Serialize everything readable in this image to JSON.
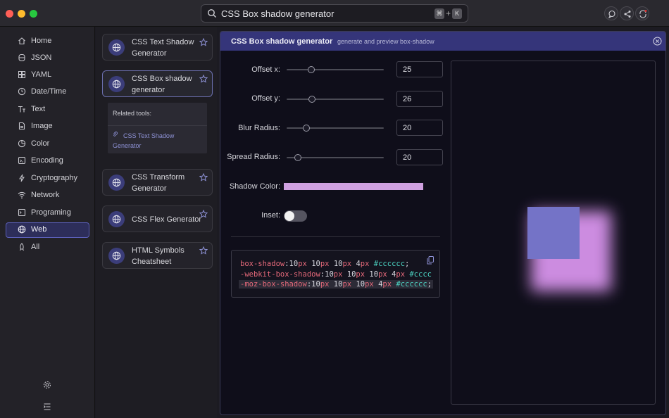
{
  "window": {
    "traffic_colors": [
      "#ff5f57",
      "#febc2e",
      "#28c840"
    ]
  },
  "search": {
    "value": "CSS Box shadow generator",
    "shortcut_key1": "⌘",
    "shortcut_plus": "+",
    "shortcut_key2": "K"
  },
  "sidebar": {
    "items": [
      {
        "label": "Home",
        "icon": "home-icon"
      },
      {
        "label": "JSON",
        "icon": "json-icon"
      },
      {
        "label": "YAML",
        "icon": "yaml-icon"
      },
      {
        "label": "Date/Time",
        "icon": "clock-icon"
      },
      {
        "label": "Text",
        "icon": "text-icon"
      },
      {
        "label": "Image",
        "icon": "image-icon"
      },
      {
        "label": "Color",
        "icon": "palette-icon"
      },
      {
        "label": "Encoding",
        "icon": "encoding-icon"
      },
      {
        "label": "Cryptography",
        "icon": "bolt-icon"
      },
      {
        "label": "Network",
        "icon": "wifi-icon"
      },
      {
        "label": "Programing",
        "icon": "terminal-icon"
      },
      {
        "label": "Web",
        "icon": "globe-icon",
        "active": true
      },
      {
        "label": "All",
        "icon": "rocket-icon"
      }
    ]
  },
  "tools": {
    "items": [
      {
        "name": "CSS Text Shadow Generator"
      },
      {
        "name": "CSS Box shadow generator",
        "active": true
      },
      {
        "name": "CSS Transform Generator"
      },
      {
        "name": "CSS Flex Generator"
      },
      {
        "name": "HTML Symbols Cheatsheet"
      }
    ],
    "related_title": "Related tools:",
    "related_link": "CSS Text Shadow Generator"
  },
  "panel": {
    "title": "CSS Box shadow generator",
    "subtitle": "generate and preview box-shadow",
    "offset_x_label": "Offset x:",
    "offset_x": "25",
    "offset_y_label": "Offset y:",
    "offset_y": "26",
    "blur_label": "Blur Radius:",
    "blur": "20",
    "spread_label": "Spread Radius:",
    "spread": "20",
    "shadow_color_label": "Shadow Color:",
    "shadow_color": "#cfa0e0",
    "inset_label": "Inset:",
    "inset": false
  },
  "code": {
    "line1_prop": "box-shadow",
    "line1_colon": ":",
    "line1_a": "10",
    "line1_b": "10",
    "line1_c": "10",
    "line1_d": "4",
    "line1_hex": "#cccccc",
    "line2_prop": "-webkit-box-shadow",
    "line2_hex": "#cccc",
    "line3_prop": "-moz-box-shadow",
    "line3_hex": "#cccccc",
    "unit": "px",
    "semicolon": ";"
  },
  "preview": {
    "box_color": "#7473c7",
    "shadow_color": "#cc8ce0"
  }
}
